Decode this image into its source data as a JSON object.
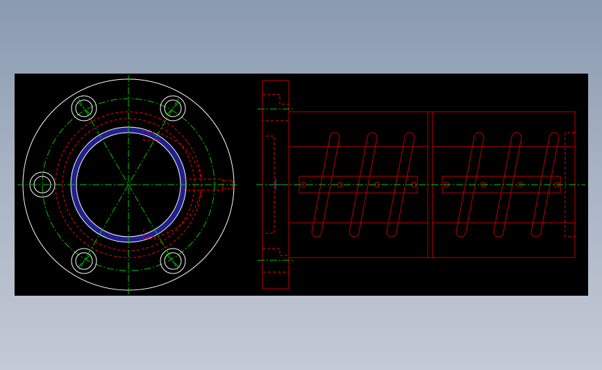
{
  "viewport": {
    "background": "#000000",
    "outer_background": "#8a9ab0"
  },
  "colors": {
    "outline": "#ffffff",
    "centerline": "#00c800",
    "hidden": "#ff0000",
    "section": "#c00000",
    "highlight": "#202090",
    "marker": "#4060ff"
  },
  "views": [
    {
      "name": "flange-front-view"
    },
    {
      "name": "flange-side-section"
    },
    {
      "name": "nut-body-section-1"
    },
    {
      "name": "nut-body-section-2"
    }
  ]
}
